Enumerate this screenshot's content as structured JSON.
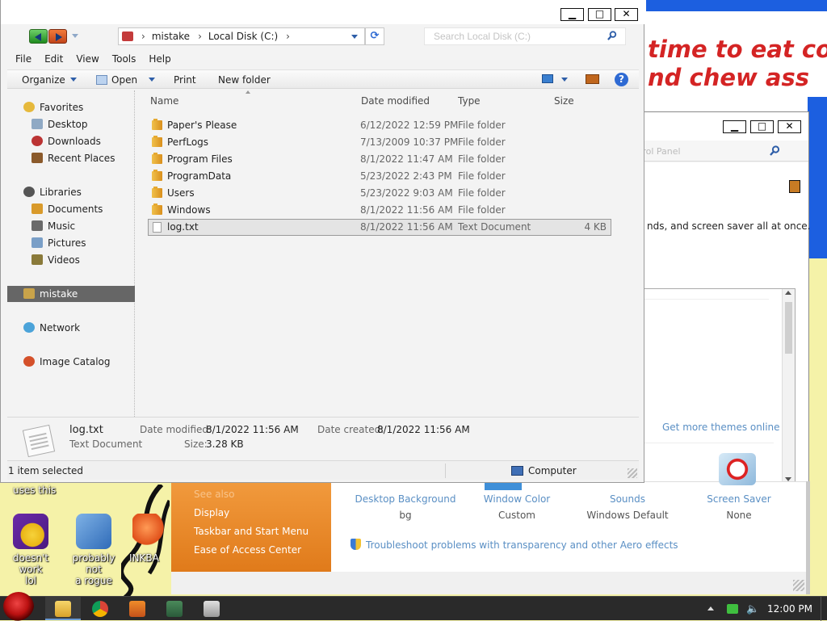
{
  "wallpaper": {
    "line1": "time to eat coo",
    "line2": "nd chew ass"
  },
  "desktop_icons": {
    "partial_label": "uses this",
    "icon1_line1": "doesn't work",
    "icon1_line2": "lol",
    "icon2_line1": "probably not",
    "icon2_line2": "a rogue",
    "icon3_label": "INKBA"
  },
  "control_panel": {
    "search_fragment": "trol Panel",
    "theme_text": "nds, and screen saver all at once.",
    "get_more_themes": "Get more themes online",
    "see_also_faint": "See also",
    "side_links": [
      "Display",
      "Taskbar and Start Menu",
      "Ease of Access Center"
    ],
    "items": [
      {
        "label": "Desktop Background",
        "value": "bg"
      },
      {
        "label": "Window Color",
        "value": "Custom"
      },
      {
        "label": "Sounds",
        "value": "Windows Default"
      },
      {
        "label": "Screen Saver",
        "value": "None"
      }
    ],
    "troubleshoot": "Troubleshoot problems with transparency and other Aero effects"
  },
  "window_buttons": {
    "minimize": "▁",
    "maximize": "□",
    "close": "✕"
  },
  "address": {
    "crumbs": [
      "mistake",
      "Local Disk (C:)"
    ],
    "search_placeholder": "Search Local Disk (C:)"
  },
  "menu": [
    "File",
    "Edit",
    "View",
    "Tools",
    "Help"
  ],
  "toolbar": {
    "organize": "Organize",
    "open": "Open",
    "print": "Print",
    "new_folder": "New folder",
    "help": "?"
  },
  "nav": {
    "favorites": "Favorites",
    "desktop": "Desktop",
    "downloads": "Downloads",
    "recent": "Recent Places",
    "libraries": "Libraries",
    "documents": "Documents",
    "music": "Music",
    "pictures": "Pictures",
    "videos": "Videos",
    "homegroup": "mistake",
    "network": "Network",
    "image_catalog": "Image Catalog"
  },
  "columns": {
    "name": "Name",
    "date": "Date modified",
    "type": "Type",
    "size": "Size"
  },
  "files": [
    {
      "name": "Paper's Please",
      "date": "6/12/2022 12:59 PM",
      "type": "File folder",
      "size": ""
    },
    {
      "name": "PerfLogs",
      "date": "7/13/2009 10:37 PM",
      "type": "File folder",
      "size": ""
    },
    {
      "name": "Program Files",
      "date": "8/1/2022 11:47 AM",
      "type": "File folder",
      "size": ""
    },
    {
      "name": "ProgramData",
      "date": "5/23/2022 2:43 PM",
      "type": "File folder",
      "size": ""
    },
    {
      "name": "Users",
      "date": "5/23/2022 9:03 AM",
      "type": "File folder",
      "size": ""
    },
    {
      "name": "Windows",
      "date": "8/1/2022 11:56 AM",
      "type": "File folder",
      "size": ""
    },
    {
      "name": "log.txt",
      "date": "8/1/2022 11:56 AM",
      "type": "Text Document",
      "size": "4 KB"
    }
  ],
  "details": {
    "filename": "log.txt",
    "filetype": "Text Document",
    "modified_label": "Date modified:",
    "modified_value": "8/1/2022 11:56 AM",
    "created_label": "Date created:",
    "created_value": "8/1/2022 11:56 AM",
    "size_label": "Size:",
    "size_value": "3.28 KB"
  },
  "status": {
    "selected": "1 item selected",
    "location": "Computer"
  },
  "taskbar": {
    "clock": "12:00 PM"
  },
  "colors": {
    "accent": "#2e6ad3",
    "selected_nav": "#666666",
    "link": "#5a8fc4",
    "wallpaper_text": "#d42424"
  }
}
